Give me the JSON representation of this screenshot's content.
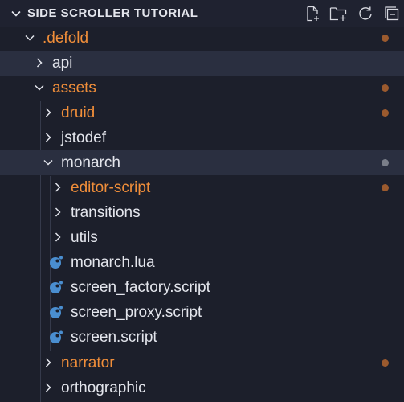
{
  "explorer": {
    "title": "SIDE SCROLLER TUTORIAL",
    "actions": [
      {
        "name": "new-file-icon"
      },
      {
        "name": "new-folder-icon"
      },
      {
        "name": "refresh-icon"
      },
      {
        "name": "collapse-all-icon"
      }
    ]
  },
  "colors": {
    "background": "#1c1f2b",
    "header_background": "#1f2230",
    "hover_background": "#2a2f40",
    "text": "#e3e5ec",
    "modified_text": "#f08e3a",
    "modified_dot": "#9b5a2e",
    "neutral_dot": "#7a7e89",
    "lua_icon": "#4a8ed0"
  },
  "tree": [
    {
      "label": ".defold",
      "kind": "folder",
      "expanded": true,
      "modified": true,
      "dot": "modified"
    },
    {
      "label": "api",
      "kind": "folder",
      "expanded": false,
      "modified": false,
      "active": true
    },
    {
      "label": "assets",
      "kind": "folder",
      "expanded": true,
      "modified": true,
      "dot": "modified"
    },
    {
      "label": "druid",
      "kind": "folder",
      "expanded": false,
      "modified": true,
      "dot": "modified"
    },
    {
      "label": "jstodef",
      "kind": "folder",
      "expanded": false,
      "modified": false
    },
    {
      "label": "monarch",
      "kind": "folder",
      "expanded": true,
      "modified": false,
      "active": true,
      "dot": "neutral"
    },
    {
      "label": "editor-script",
      "kind": "folder",
      "expanded": false,
      "modified": true,
      "dot": "modified"
    },
    {
      "label": "transitions",
      "kind": "folder",
      "expanded": false,
      "modified": false
    },
    {
      "label": "utils",
      "kind": "folder",
      "expanded": false,
      "modified": false
    },
    {
      "label": "monarch.lua",
      "kind": "file",
      "icon": "lua-file-icon"
    },
    {
      "label": "screen_factory.script",
      "kind": "file",
      "icon": "lua-file-icon"
    },
    {
      "label": "screen_proxy.script",
      "kind": "file",
      "icon": "lua-file-icon"
    },
    {
      "label": "screen.script",
      "kind": "file",
      "icon": "lua-file-icon"
    },
    {
      "label": "narrator",
      "kind": "folder",
      "expanded": false,
      "modified": true,
      "dot": "modified"
    },
    {
      "label": "orthographic",
      "kind": "folder",
      "expanded": false,
      "modified": false
    }
  ]
}
